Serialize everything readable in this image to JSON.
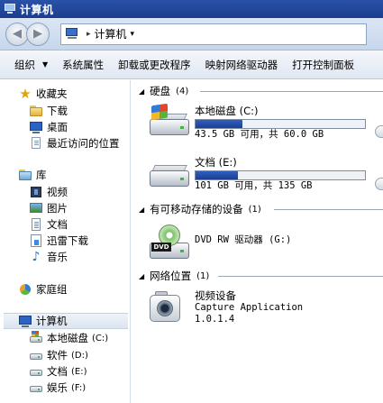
{
  "window": {
    "title": "计算机"
  },
  "address": {
    "crumb": "计算机",
    "separator": "▸",
    "dropdown": "▾"
  },
  "nav_buttons": {
    "back": "◀",
    "forward": "▶"
  },
  "toolbar": {
    "items": [
      {
        "label": "组织",
        "caret": "▼"
      },
      {
        "label": "系统属性"
      },
      {
        "label": "卸载或更改程序"
      },
      {
        "label": "映射网络驱动器"
      },
      {
        "label": "打开控制面板"
      }
    ]
  },
  "sidebar": {
    "favorites": {
      "label": "收藏夹",
      "items": [
        "下载",
        "桌面",
        "最近访问的位置"
      ]
    },
    "libraries": {
      "label": "库",
      "items": [
        "视频",
        "图片",
        "文档",
        "迅雷下载",
        "音乐"
      ]
    },
    "homegroup": {
      "label": "家庭组"
    },
    "computer": {
      "label": "计算机",
      "items": [
        {
          "label": "本地磁盘",
          "drive": "(C:)"
        },
        {
          "label": "软件",
          "drive": "(D:)"
        },
        {
          "label": "文档",
          "drive": "(E:)"
        },
        {
          "label": "娱乐",
          "drive": "(F:)"
        }
      ]
    }
  },
  "content": {
    "groups": {
      "hdd": {
        "label": "硬盘",
        "count": "(4)"
      },
      "removable": {
        "label": "有可移动存储的设备",
        "count": "(1)"
      },
      "network": {
        "label": "网络位置",
        "count": "(1)"
      }
    },
    "drives": [
      {
        "name": "本地磁盘 (C:)",
        "free_text": "43.5 GB 可用，共 60.0 GB",
        "used_fraction": 0.275
      },
      {
        "name": "文档 (E:)",
        "free_text": "101 GB 可用，共 135 GB",
        "used_fraction": 0.252
      }
    ],
    "dvd": {
      "name": "DVD RW 驱动器 (G:)",
      "badge": "DVD"
    },
    "network_device": {
      "name": "视频设备",
      "line2": "Capture Application",
      "line3": "1.0.1.4"
    }
  },
  "colors": {
    "title_bar": "#1b3d8f",
    "capacity_fill": "#1d3e8e",
    "selection": "#dbe4ef"
  }
}
